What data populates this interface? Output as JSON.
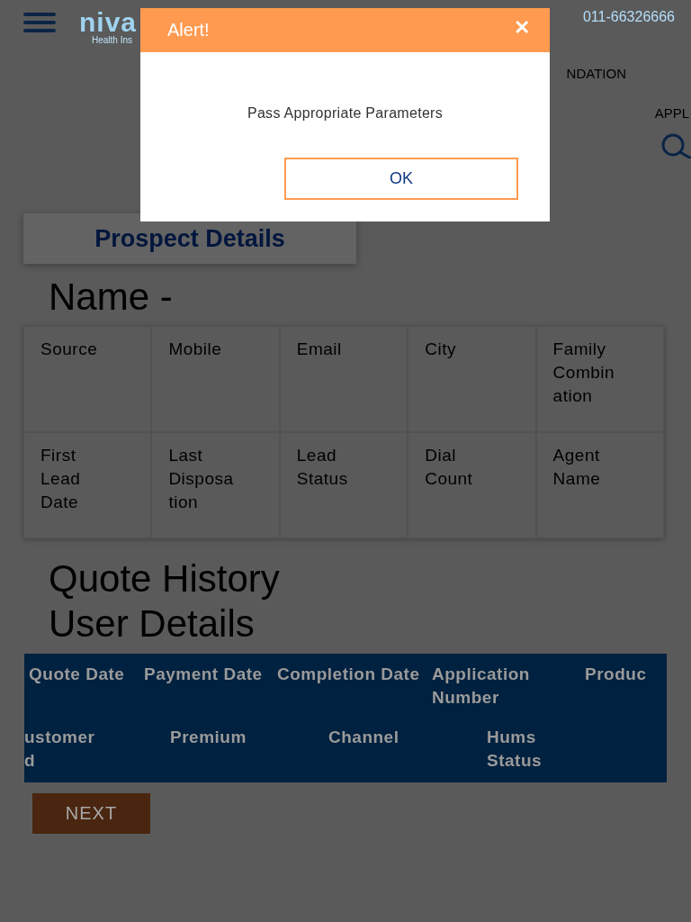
{
  "header": {
    "logo": "niva",
    "logo_subtitle": "Health Ins",
    "phone": "011-66326666"
  },
  "nav": {
    "items": [
      "NDATION"
    ],
    "second_row": "APPL"
  },
  "prospect": {
    "tab": "Prospect Details",
    "name_heading": "Name -",
    "fields": [
      [
        "Source",
        "Mobile",
        "Email",
        "City",
        "Family Combin ation"
      ],
      [
        "First Lead Date",
        "Last Disposa tion",
        "Lead Status",
        "Dial Count",
        "Agent Name"
      ]
    ]
  },
  "quote_history": {
    "title": "Quote History",
    "subtitle": "User Details",
    "header_rows": [
      [
        "Quote Date",
        "Payment Date",
        "Completion Date",
        "Application Number",
        "Produc"
      ],
      [
        "ustomer d",
        "Premium",
        "Channel",
        "Hums Status"
      ]
    ]
  },
  "next_button": "NEXT",
  "dialog": {
    "title": "Alert!",
    "close": "✕",
    "message": "Pass Appropriate Parameters",
    "ok": "OK"
  }
}
